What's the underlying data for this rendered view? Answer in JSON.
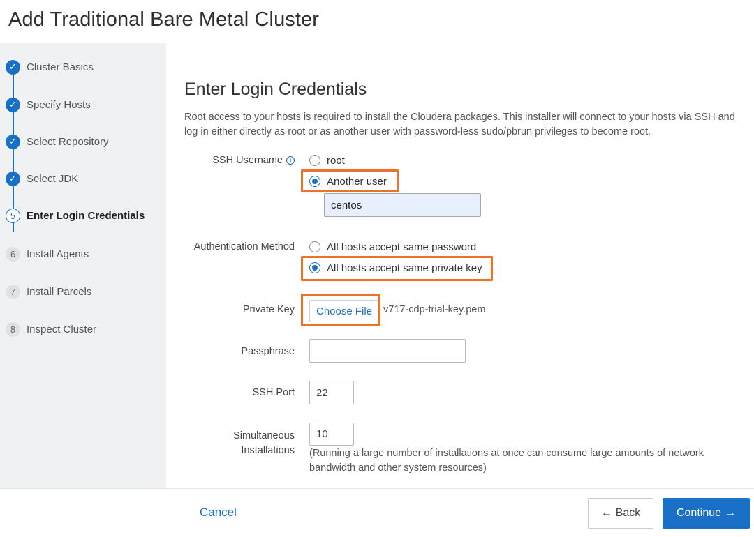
{
  "page": {
    "title": "Add Traditional Bare Metal Cluster"
  },
  "steps": [
    {
      "number": "1",
      "label": "Cluster Basics",
      "status": "done"
    },
    {
      "number": "2",
      "label": "Specify Hosts",
      "status": "done"
    },
    {
      "number": "3",
      "label": "Select Repository",
      "status": "done"
    },
    {
      "number": "4",
      "label": "Select JDK",
      "status": "done"
    },
    {
      "number": "5",
      "label": "Enter Login Credentials",
      "status": "current"
    },
    {
      "number": "6",
      "label": "Install Agents",
      "status": "todo"
    },
    {
      "number": "7",
      "label": "Install Parcels",
      "status": "todo"
    },
    {
      "number": "8",
      "label": "Inspect Cluster",
      "status": "todo"
    }
  ],
  "section": {
    "title": "Enter Login Credentials",
    "description": "Root access to your hosts is required to install the Cloudera packages. This installer will connect to your hosts via SSH and log in either directly as root or as another user with password-less sudo/pbrun privileges to become root."
  },
  "ssh_username": {
    "label": "SSH Username",
    "options": [
      "root",
      "Another user"
    ],
    "selected": "Another user",
    "value": "centos"
  },
  "auth_method": {
    "label": "Authentication Method",
    "options": [
      "All hosts accept same password",
      "All hosts accept same private key"
    ],
    "selected": "All hosts accept same private key"
  },
  "private_key": {
    "label": "Private Key",
    "button": "Choose File",
    "file_name": "v717-cdp-trial-key.pem"
  },
  "passphrase": {
    "label": "Passphrase",
    "value": ""
  },
  "ssh_port": {
    "label": "SSH Port",
    "value": "22"
  },
  "simultaneous": {
    "label_line1": "Simultaneous",
    "label_line2": "Installations",
    "value": "10",
    "hint": "(Running a large number of installations at once can consume large amounts of network bandwidth and other system resources)"
  },
  "footer": {
    "cancel": "Cancel",
    "back": "Back",
    "continue": "Continue"
  },
  "colors": {
    "accent": "#1a6fc7",
    "highlight": "#ee7228",
    "sidebar": "#eff1f3"
  },
  "icons": {
    "done": "check-icon",
    "info": "info-icon",
    "continue": "arrow-right-icon",
    "back": "arrow-left-icon"
  }
}
